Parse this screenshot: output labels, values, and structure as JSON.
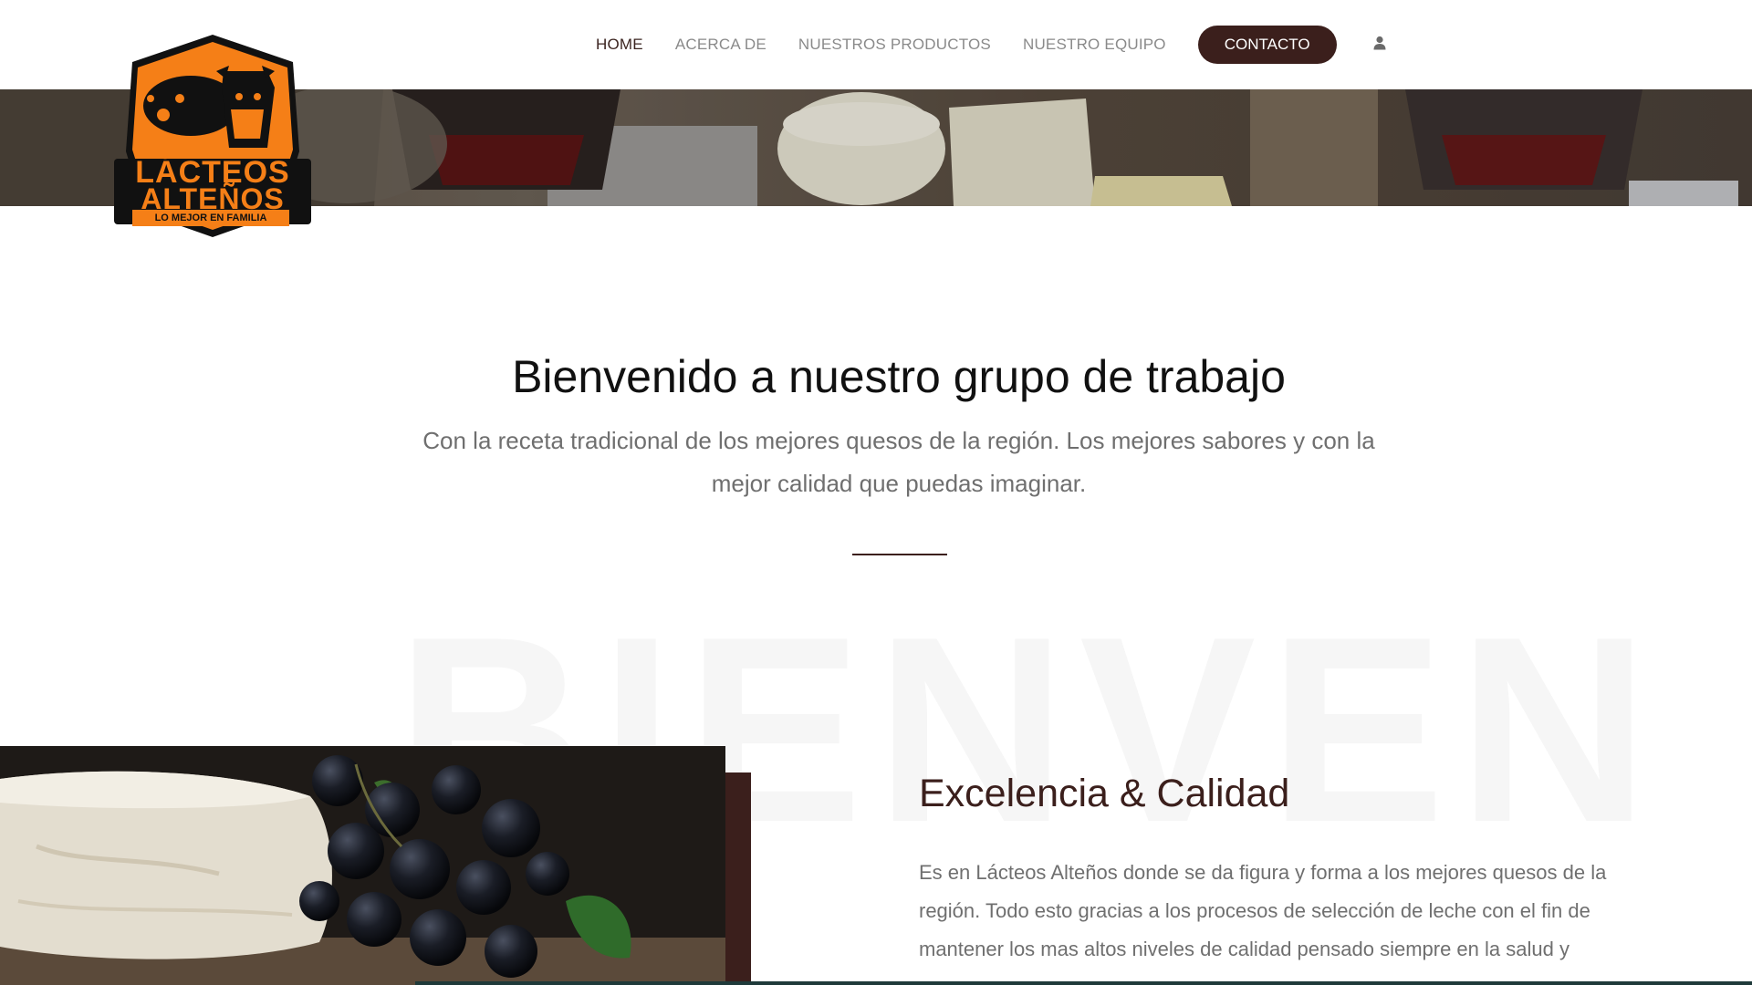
{
  "brand": {
    "logo_line1": "LÁCTEOS",
    "logo_line2": "ALTEÑOS",
    "logo_tagline": "LO MEJOR EN FAMILIA",
    "logo_color": "#f57f17"
  },
  "nav": {
    "items": [
      {
        "label": "HOME",
        "active": true
      },
      {
        "label": "ACERCA DE"
      },
      {
        "label": "NUESTROS PRODUCTOS"
      },
      {
        "label": "NUESTRO EQUIPO"
      }
    ],
    "cta_label": "CONTACTO",
    "user_icon": "user-icon"
  },
  "welcome": {
    "title": "Bienvenido a nuestro grupo de trabajo",
    "text": "Con la receta tradicional de los mejores quesos de la región. Los mejores sabores y con la mejor calidad que puedas imaginar."
  },
  "watermark": "BIENVEN",
  "feature": {
    "title": "Excelencia & Calidad",
    "text": "Es en Lácteos Alteños donde se da figura y forma a los mejores quesos de la región. Todo esto gracias a los procesos de selección de leche con el fin de mantener los mas altos niveles de calidad pensado siempre en la salud y"
  },
  "colors": {
    "accent": "#3b1f1c",
    "nav_text": "#8a8a8a",
    "body_text": "#6f6f6f"
  }
}
